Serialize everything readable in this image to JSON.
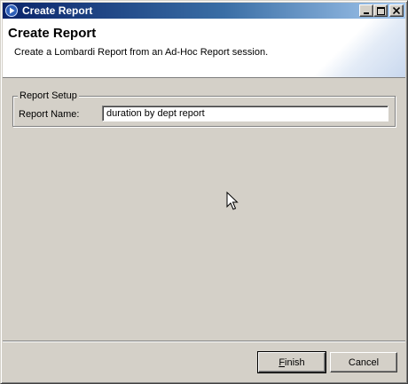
{
  "window": {
    "title": "Create Report",
    "title_icon": "arrow-play-icon",
    "controls": [
      "minimize-icon",
      "maximize-icon",
      "close-icon"
    ]
  },
  "header": {
    "title": "Create Report",
    "description": "Create a Lombardi Report from an Ad-Hoc Report session."
  },
  "report_setup": {
    "group_label": "Report Setup",
    "name_label": "Report Name:",
    "name_value": "duration by dept report"
  },
  "buttons": {
    "finish_mnemonic": "F",
    "finish_rest": "inish",
    "cancel_label": "Cancel"
  },
  "colors": {
    "titlebar_start": "#0a246a",
    "titlebar_end": "#a6caf0",
    "face": "#d4d0c8"
  }
}
